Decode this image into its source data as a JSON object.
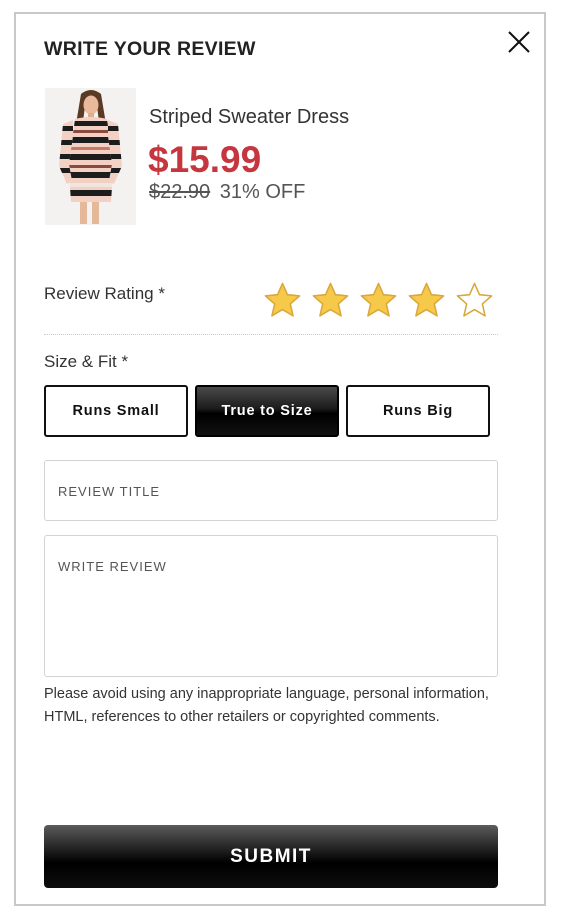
{
  "modal": {
    "title": "WRITE YOUR REVIEW"
  },
  "product": {
    "name": "Striped Sweater Dress",
    "price": "$15.99",
    "original_price": "$22.90",
    "discount": "31% OFF"
  },
  "rating": {
    "label": "Review Rating *",
    "value": 4,
    "max": 5
  },
  "size_fit": {
    "label": "Size & Fit *",
    "options": [
      "Runs Small",
      "True to Size",
      "Runs Big"
    ],
    "selected": "True to Size"
  },
  "fields": {
    "title_placeholder": "REVIEW TITLE",
    "review_placeholder": "WRITE REVIEW"
  },
  "note": "Please avoid using any inappropriate language, personal information, HTML, references to other retailers or copyrighted comments.",
  "submit_label": "SUBMIT",
  "colors": {
    "price": "#c5363f",
    "star": "#f6c94a",
    "star_outline": "#d9a83a"
  }
}
